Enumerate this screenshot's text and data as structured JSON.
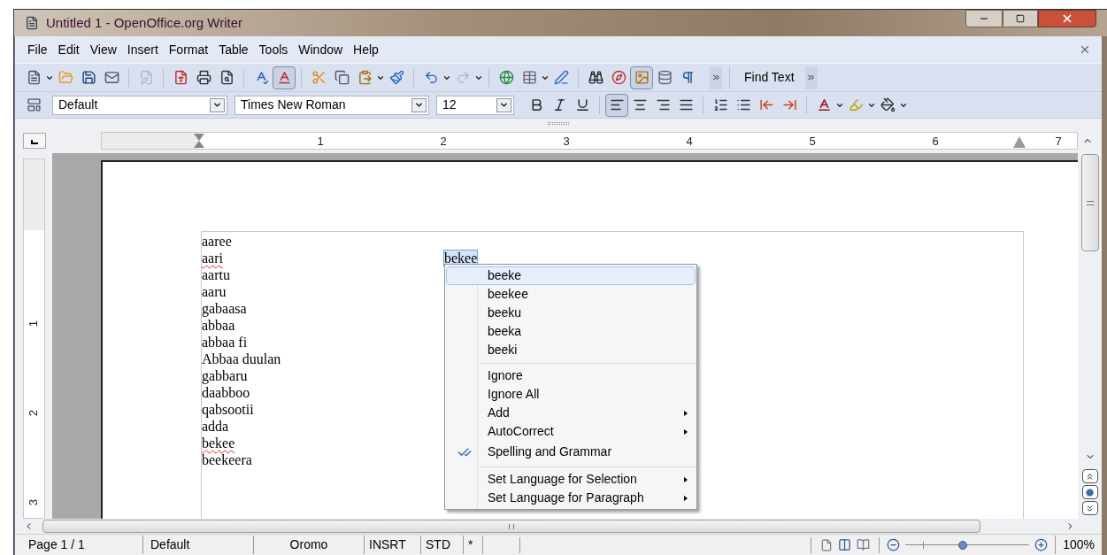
{
  "window": {
    "title": "Untitled 1 - OpenOffice.org Writer"
  },
  "menu": [
    {
      "label": "File"
    },
    {
      "label": "Edit"
    },
    {
      "label": "View"
    },
    {
      "label": "Insert"
    },
    {
      "label": "Format"
    },
    {
      "label": "Table"
    },
    {
      "label": "Tools"
    },
    {
      "label": "Window"
    },
    {
      "label": "Help"
    }
  ],
  "standard_toolbar": {
    "edit_file_disabled": true,
    "auto_spellcheck_on": true,
    "redo_disabled": true,
    "gallery_on": true,
    "find_text": "Find Text"
  },
  "formatting_toolbar": {
    "paragraph_style": "Default",
    "font_name": "Times New Roman",
    "font_size": "12",
    "bold": false,
    "italic": false,
    "underline": false,
    "align_left": true,
    "align_center": false,
    "align_right": false,
    "justify": false
  },
  "ruler": {
    "numbers": [
      "1",
      "2",
      "3",
      "4",
      "5",
      "6",
      "7"
    ],
    "vertical_numbers": [
      "1",
      "2",
      "3"
    ]
  },
  "document": {
    "lines": [
      {
        "text": "aaree",
        "misspelled": false
      },
      {
        "text": "aari",
        "misspelled": true
      },
      {
        "text": "aartu",
        "misspelled": false
      },
      {
        "text": "aaru",
        "misspelled": false
      },
      {
        "text": "gabaasa",
        "misspelled": false
      },
      {
        "text": "abbaa",
        "misspelled": false
      },
      {
        "text": "abbaa fi",
        "misspelled": false
      },
      {
        "text": "Abbaa duulan",
        "misspelled": false
      },
      {
        "text": "gabbaru",
        "misspelled": false
      },
      {
        "text": "daabboo",
        "misspelled": false
      },
      {
        "text": "qabsootii",
        "misspelled": false
      },
      {
        "text": "adda",
        "misspelled": false
      },
      {
        "text": "bekee",
        "misspelled": true
      },
      {
        "text": "beekeera",
        "misspelled": false
      }
    ],
    "popup_word": {
      "text": "bekee",
      "selected": true
    }
  },
  "context_menu": [
    {
      "kind": "suggestion",
      "label": "beeke",
      "selected": true
    },
    {
      "kind": "suggestion",
      "label": "beekee",
      "selected": false
    },
    {
      "kind": "suggestion",
      "label": "beeku",
      "selected": false
    },
    {
      "kind": "suggestion",
      "label": "beeka",
      "selected": false
    },
    {
      "kind": "suggestion",
      "label": "beeki",
      "selected": false
    },
    {
      "kind": "separator"
    },
    {
      "kind": "item",
      "label": "Ignore",
      "selected": false
    },
    {
      "kind": "item",
      "label": "Ignore All",
      "selected": false
    },
    {
      "kind": "submenu",
      "label": "Add",
      "selected": false
    },
    {
      "kind": "submenu",
      "label": "AutoCorrect",
      "selected": false
    },
    {
      "kind": "icon_item",
      "label": "Spelling and Grammar",
      "selected": false
    },
    {
      "kind": "separator"
    },
    {
      "kind": "submenu",
      "label": "Set Language for Selection",
      "selected": false
    },
    {
      "kind": "submenu",
      "label": "Set Language for Paragraph",
      "selected": false
    }
  ],
  "status_bar": {
    "page": "Page 1 / 1",
    "page_style": "Default",
    "language": "Oromo",
    "insert_mode": "INSRT",
    "selection_mode": "STD",
    "modified": "*",
    "zoom": {
      "level": 0.46,
      "reading": "100%"
    }
  }
}
